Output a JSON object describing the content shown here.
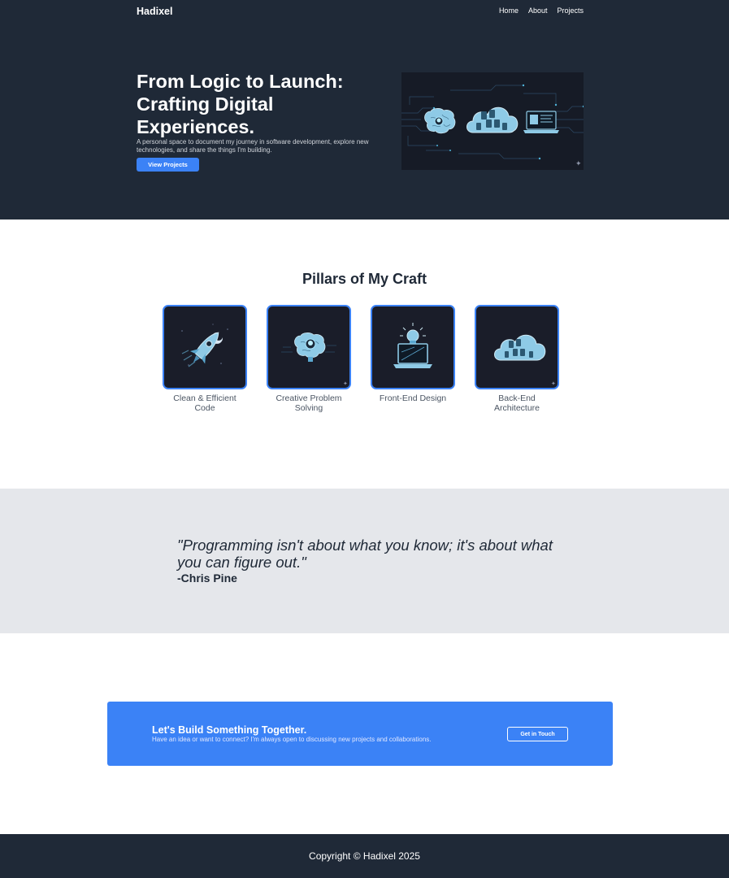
{
  "nav": {
    "brand": "Hadixel",
    "links": [
      "Home",
      "About",
      "Projects"
    ]
  },
  "hero": {
    "title": "From Logic to Launch: Crafting Digital Experiences.",
    "subtitle": "A personal space to document my journey in software development, explore new technologies, and share the things I'm building.",
    "button_label": "View Projects",
    "image_icon": "brain-cloud-laptop-circuit-illustration"
  },
  "pillars": {
    "title": "Pillars of My Craft",
    "items": [
      {
        "label": "Clean & Efficient Code",
        "icon": "rocket-icon"
      },
      {
        "label": "Creative Problem Solving",
        "icon": "brain-lightbulb-icon"
      },
      {
        "label": "Front-End Design",
        "icon": "laptop-lightbulb-icon"
      },
      {
        "label": "Back-End Architecture",
        "icon": "cloud-server-icon"
      }
    ]
  },
  "quote": {
    "text": "\"Programming isn't about what you know; it's about what you can figure out.\"",
    "author": "-Chris Pine"
  },
  "cta": {
    "title": "Let's Build Something Together.",
    "subtitle": "Have an idea or want to connect? I'm always open to discussing new projects and collaborations.",
    "button_label": "Get in Touch"
  },
  "footer": {
    "copyright": "Copyright © Hadixel 2025"
  },
  "colors": {
    "dark": "#1f2937",
    "accent": "#3b82f6",
    "quote_bg": "#e5e7eb",
    "tile_bg": "#1a1d29",
    "icon_fill": "#8ecae6"
  }
}
